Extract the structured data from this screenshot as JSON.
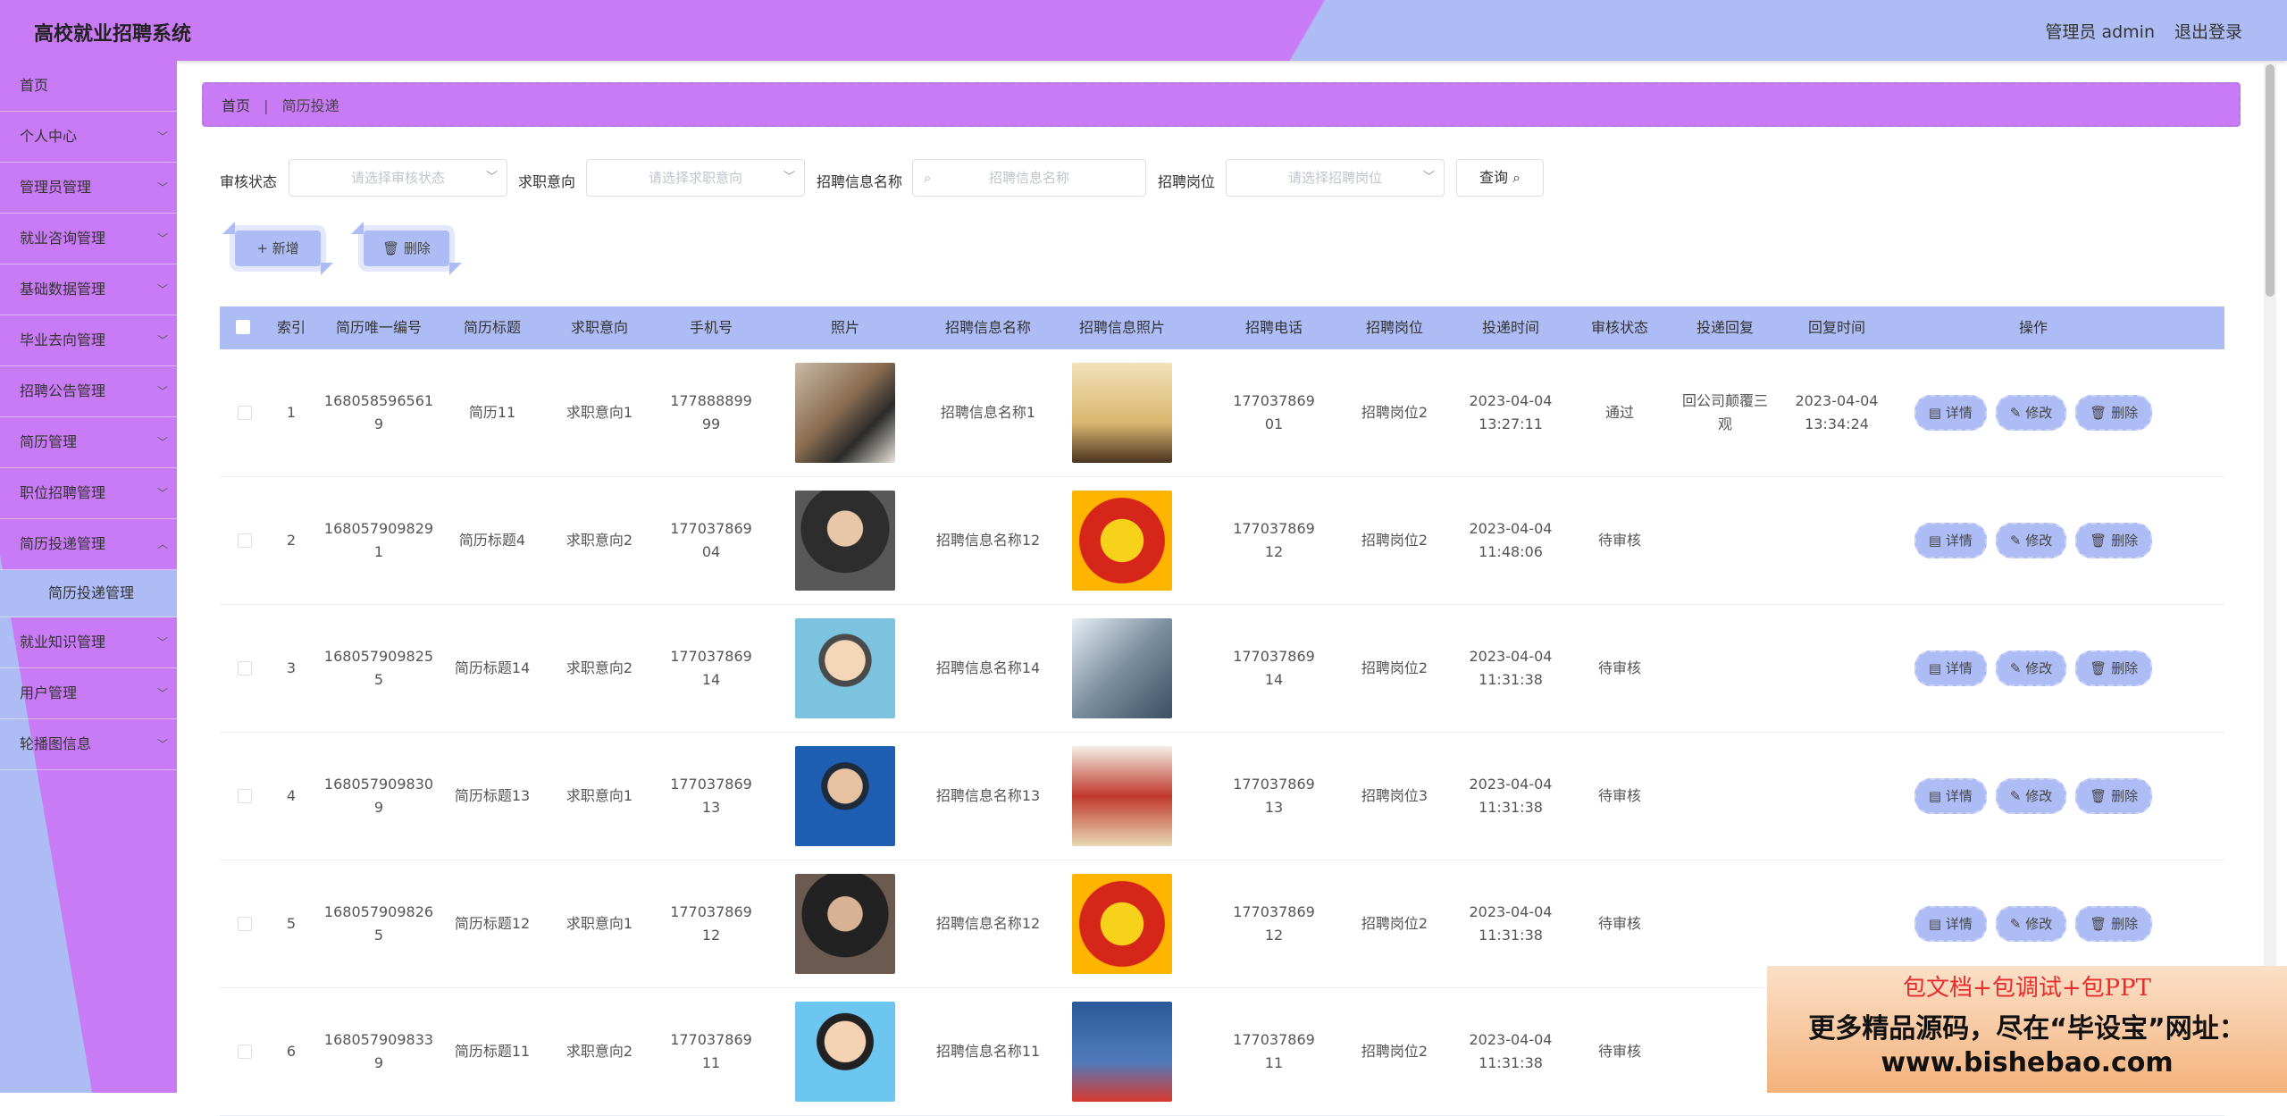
{
  "header": {
    "title": "高校就业招聘系统",
    "admin_label": "管理员 admin",
    "logout": "退出登录"
  },
  "sidebar": {
    "items": [
      {
        "label": "首页"
      },
      {
        "label": "个人中心"
      },
      {
        "label": "管理员管理"
      },
      {
        "label": "就业咨询管理"
      },
      {
        "label": "基础数据管理"
      },
      {
        "label": "毕业去向管理"
      },
      {
        "label": "招聘公告管理"
      },
      {
        "label": "简历管理"
      },
      {
        "label": "职位招聘管理"
      },
      {
        "label": "简历投递管理"
      },
      {
        "label": "简历投递管理"
      },
      {
        "label": "就业知识管理"
      },
      {
        "label": "用户管理"
      },
      {
        "label": "轮播图信息"
      }
    ]
  },
  "breadcrumb": {
    "home": "首页",
    "sep": "|",
    "current": "简历投递"
  },
  "filters": {
    "status_label": "审核状态",
    "status_placeholder": "请选择审核状态",
    "intent_label": "求职意向",
    "intent_placeholder": "请选择求职意向",
    "name_label": "招聘信息名称",
    "name_placeholder": "招聘信息名称",
    "post_label": "招聘岗位",
    "post_placeholder": "请选择招聘岗位",
    "query_label": "查询"
  },
  "actions": {
    "add": "+ 新增",
    "delete": "删除"
  },
  "table": {
    "headers": [
      "索引",
      "简历唯一编号",
      "简历标题",
      "求职意向",
      "手机号",
      "照片",
      "招聘信息名称",
      "招聘信息照片",
      "招聘电话",
      "招聘岗位",
      "投递时间",
      "审核状态",
      "投递回复",
      "回复时间",
      "操作"
    ],
    "op_labels": {
      "detail": "详情",
      "edit": "修改",
      "delete": "删除"
    },
    "rows": [
      {
        "idx": "1",
        "code": "1680585965619",
        "title": "简历11",
        "intent": "求职意向1",
        "phone": "17788889999",
        "name": "招聘信息名称1",
        "tel": "17703786901",
        "post": "招聘岗位2",
        "time": "2023-04-04 13:27:11",
        "status": "通过",
        "reply": "回公司颠覆三观",
        "reply_time": "2023-04-04 13:34:24"
      },
      {
        "idx": "2",
        "code": "1680579098291",
        "title": "简历标题4",
        "intent": "求职意向2",
        "phone": "17703786904",
        "name": "招聘信息名称12",
        "tel": "17703786912",
        "post": "招聘岗位2",
        "time": "2023-04-04 11:48:06",
        "status": "待审核",
        "reply": "",
        "reply_time": ""
      },
      {
        "idx": "3",
        "code": "1680579098255",
        "title": "简历标题14",
        "intent": "求职意向2",
        "phone": "17703786914",
        "name": "招聘信息名称14",
        "tel": "17703786914",
        "post": "招聘岗位2",
        "time": "2023-04-04 11:31:38",
        "status": "待审核",
        "reply": "",
        "reply_time": ""
      },
      {
        "idx": "4",
        "code": "1680579098309",
        "title": "简历标题13",
        "intent": "求职意向1",
        "phone": "17703786913",
        "name": "招聘信息名称13",
        "tel": "17703786913",
        "post": "招聘岗位3",
        "time": "2023-04-04 11:31:38",
        "status": "待审核",
        "reply": "",
        "reply_time": ""
      },
      {
        "idx": "5",
        "code": "1680579098265",
        "title": "简历标题12",
        "intent": "求职意向1",
        "phone": "17703786912",
        "name": "招聘信息名称12",
        "tel": "17703786912",
        "post": "招聘岗位2",
        "time": "2023-04-04 11:31:38",
        "status": "待审核",
        "reply": "",
        "reply_time": ""
      },
      {
        "idx": "6",
        "code": "1680579098339",
        "title": "简历标题11",
        "intent": "求职意向2",
        "phone": "17703786911",
        "name": "招聘信息名称11",
        "tel": "17703786911",
        "post": "招聘岗位2",
        "time": "2023-04-04 11:31:38",
        "status": "待审核",
        "reply": "",
        "reply_time": ""
      }
    ]
  },
  "ad": {
    "line1": "包文档+包调试+包PPT",
    "line2": "更多精品源码，尽在“毕设宝”网址：",
    "line3": "www.bishebao.com"
  }
}
